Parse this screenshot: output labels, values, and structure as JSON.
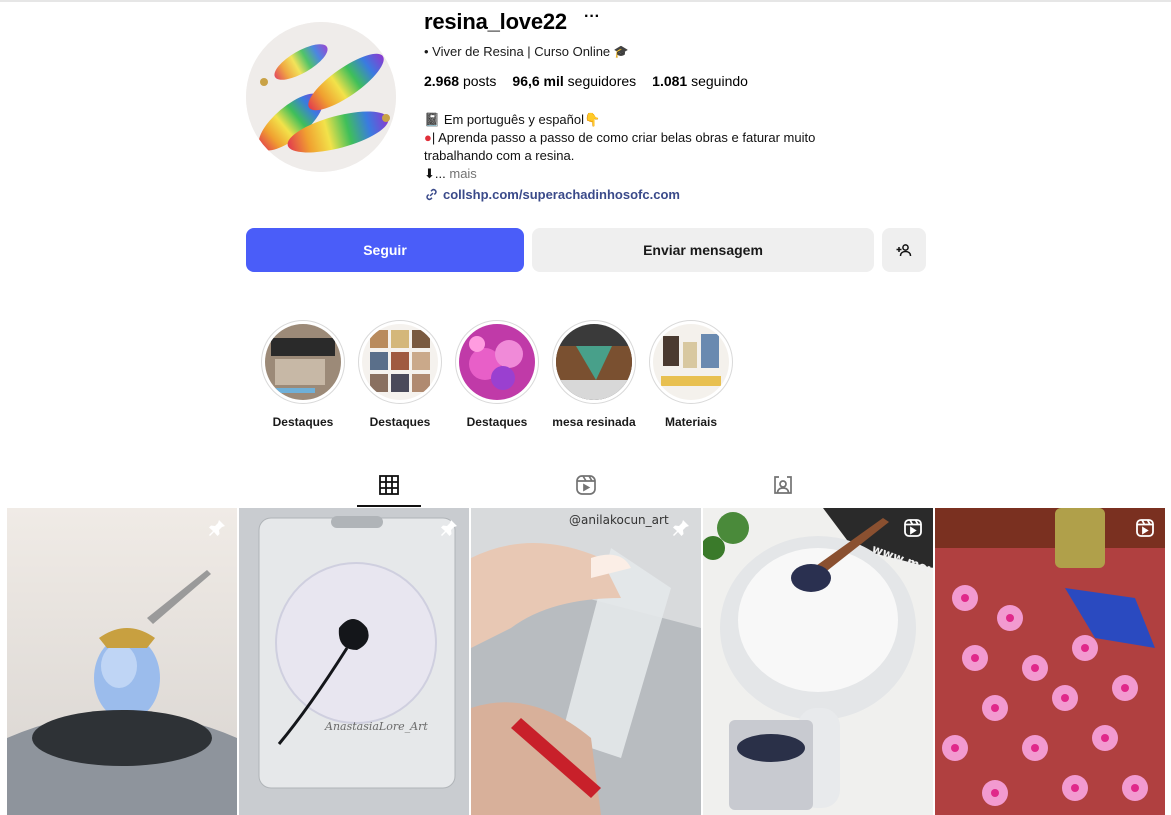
{
  "profile": {
    "username": "resina_love22",
    "category": "• Viver de Resina | Curso Online",
    "category_icon": "graduation-cap-icon",
    "stats": {
      "posts_value": "2.968",
      "posts_label": "posts",
      "followers_value": "96,6 mil",
      "followers_label": "seguidores",
      "following_value": "1.081",
      "following_label": "seguindo"
    },
    "bio": {
      "line1": "Em português y español",
      "line1_prefix_icon": "notebook-icon",
      "line1_suffix_icon": "pointing-down-icon",
      "line2": "| Aprenda passo a passo de como criar belas obras e faturar muito trabalhando com a resina.",
      "line2_prefix_icon": "red-circle-icon",
      "line3": "⬇...",
      "more": "mais"
    },
    "link": "collshp.com/superachadinhosofc.com"
  },
  "actions": {
    "follow": "Seguir",
    "message": "Enviar mensagem"
  },
  "highlights": [
    {
      "label": "Destaques"
    },
    {
      "label": "Destaques"
    },
    {
      "label": "Destaques"
    },
    {
      "label": "mesa resinada"
    },
    {
      "label": "Materiais"
    }
  ],
  "tabs": [
    {
      "name": "posts",
      "icon": "grid-icon",
      "active": true
    },
    {
      "name": "reels",
      "icon": "reels-icon",
      "active": false
    },
    {
      "name": "tagged",
      "icon": "tagged-icon",
      "active": false
    }
  ],
  "posts": [
    {
      "badge": "pin-icon",
      "watermark": ""
    },
    {
      "badge": "pin-icon",
      "watermark": "AnastasiaLore_Art"
    },
    {
      "badge": "pin-icon",
      "watermark": "@anilakocun_art"
    },
    {
      "badge": "reel-icon",
      "watermark": "www.mould"
    },
    {
      "badge": "reel-icon",
      "watermark": ""
    }
  ],
  "colors": {
    "accent": "#4a5df9",
    "button_secondary": "#efefef",
    "link": "#3a4a8a",
    "muted": "#737373"
  }
}
